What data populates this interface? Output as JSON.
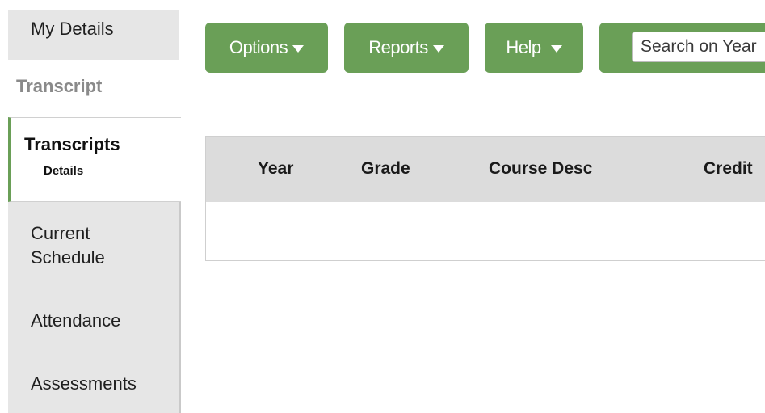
{
  "sidebar": {
    "my_details": "My Details",
    "section_label": "Transcript",
    "active_item": {
      "title": "Transcripts",
      "subtitle": "Details"
    },
    "items": [
      {
        "label": "Current\nSchedule"
      },
      {
        "label": "Attendance"
      },
      {
        "label": "Assessments"
      }
    ]
  },
  "toolbar": {
    "options_label": "Options",
    "reports_label": "Reports",
    "help_label": "Help",
    "search_placeholder": "Search on Year"
  },
  "table": {
    "columns": [
      "Year",
      "Grade",
      "Course Desc",
      "Credit"
    ],
    "rows": []
  },
  "colors": {
    "accent_green": "#6a9f57",
    "sidebar_bg": "#e6e6e6",
    "table_header_bg": "#dcdcdc",
    "section_label": "#8a8a8a"
  }
}
